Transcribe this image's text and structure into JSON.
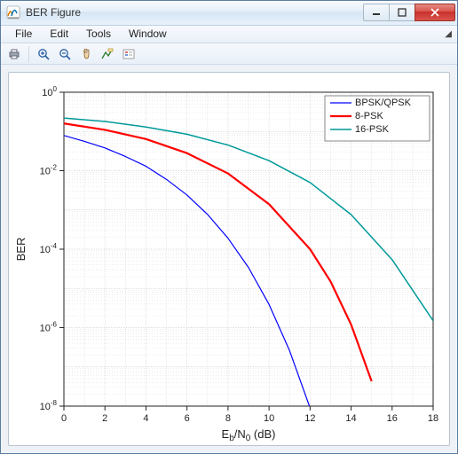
{
  "window": {
    "title": "BER Figure"
  },
  "menu": {
    "items": [
      "File",
      "Edit",
      "Tools",
      "Window"
    ]
  },
  "toolbar": {
    "icons": [
      "print-icon",
      "zoom-in-icon",
      "zoom-out-icon",
      "pan-icon",
      "data-cursor-icon",
      "legend-icon"
    ]
  },
  "chart_data": {
    "type": "line",
    "xlabel": "E_b/N_0 (dB)",
    "ylabel": "BER",
    "xlim": [
      0,
      18
    ],
    "ylim_log10": [
      -8,
      0
    ],
    "xticks": [
      0,
      2,
      4,
      6,
      8,
      10,
      12,
      14,
      16,
      18
    ],
    "ytick_exponents": [
      0,
      -2,
      -4,
      -6,
      -8
    ],
    "grid": true,
    "legend": {
      "position": "northeast",
      "entries": [
        "BPSK/QPSK",
        "8-PSK",
        "16-PSK"
      ]
    },
    "series": [
      {
        "name": "BPSK/QPSK",
        "color": "#0000ff",
        "width": 1.2,
        "x": [
          0,
          1,
          2,
          3,
          4,
          5,
          6,
          7,
          8,
          9,
          10,
          11,
          12
        ],
        "y": [
          0.079,
          0.056,
          0.038,
          0.023,
          0.013,
          0.006,
          0.0024,
          0.00077,
          0.00019,
          3.4e-05,
          3.9e-06,
          2.6e-07,
          9e-09
        ]
      },
      {
        "name": "8-PSK",
        "color": "#ff0000",
        "width": 2.2,
        "x": [
          0,
          2,
          4,
          6,
          8,
          10,
          12,
          13,
          14,
          15
        ],
        "y": [
          0.16,
          0.11,
          0.064,
          0.028,
          0.0085,
          0.0014,
          0.0001,
          1.5e-05,
          1.2e-06,
          4.3e-08
        ]
      },
      {
        "name": "16-PSK",
        "color": "#009999",
        "width": 1.5,
        "x": [
          0,
          2,
          4,
          6,
          8,
          10,
          12,
          14,
          16,
          18
        ],
        "y": [
          0.22,
          0.18,
          0.13,
          0.085,
          0.045,
          0.018,
          0.005,
          0.00076,
          5.4e-05,
          1.5e-06
        ]
      }
    ]
  }
}
